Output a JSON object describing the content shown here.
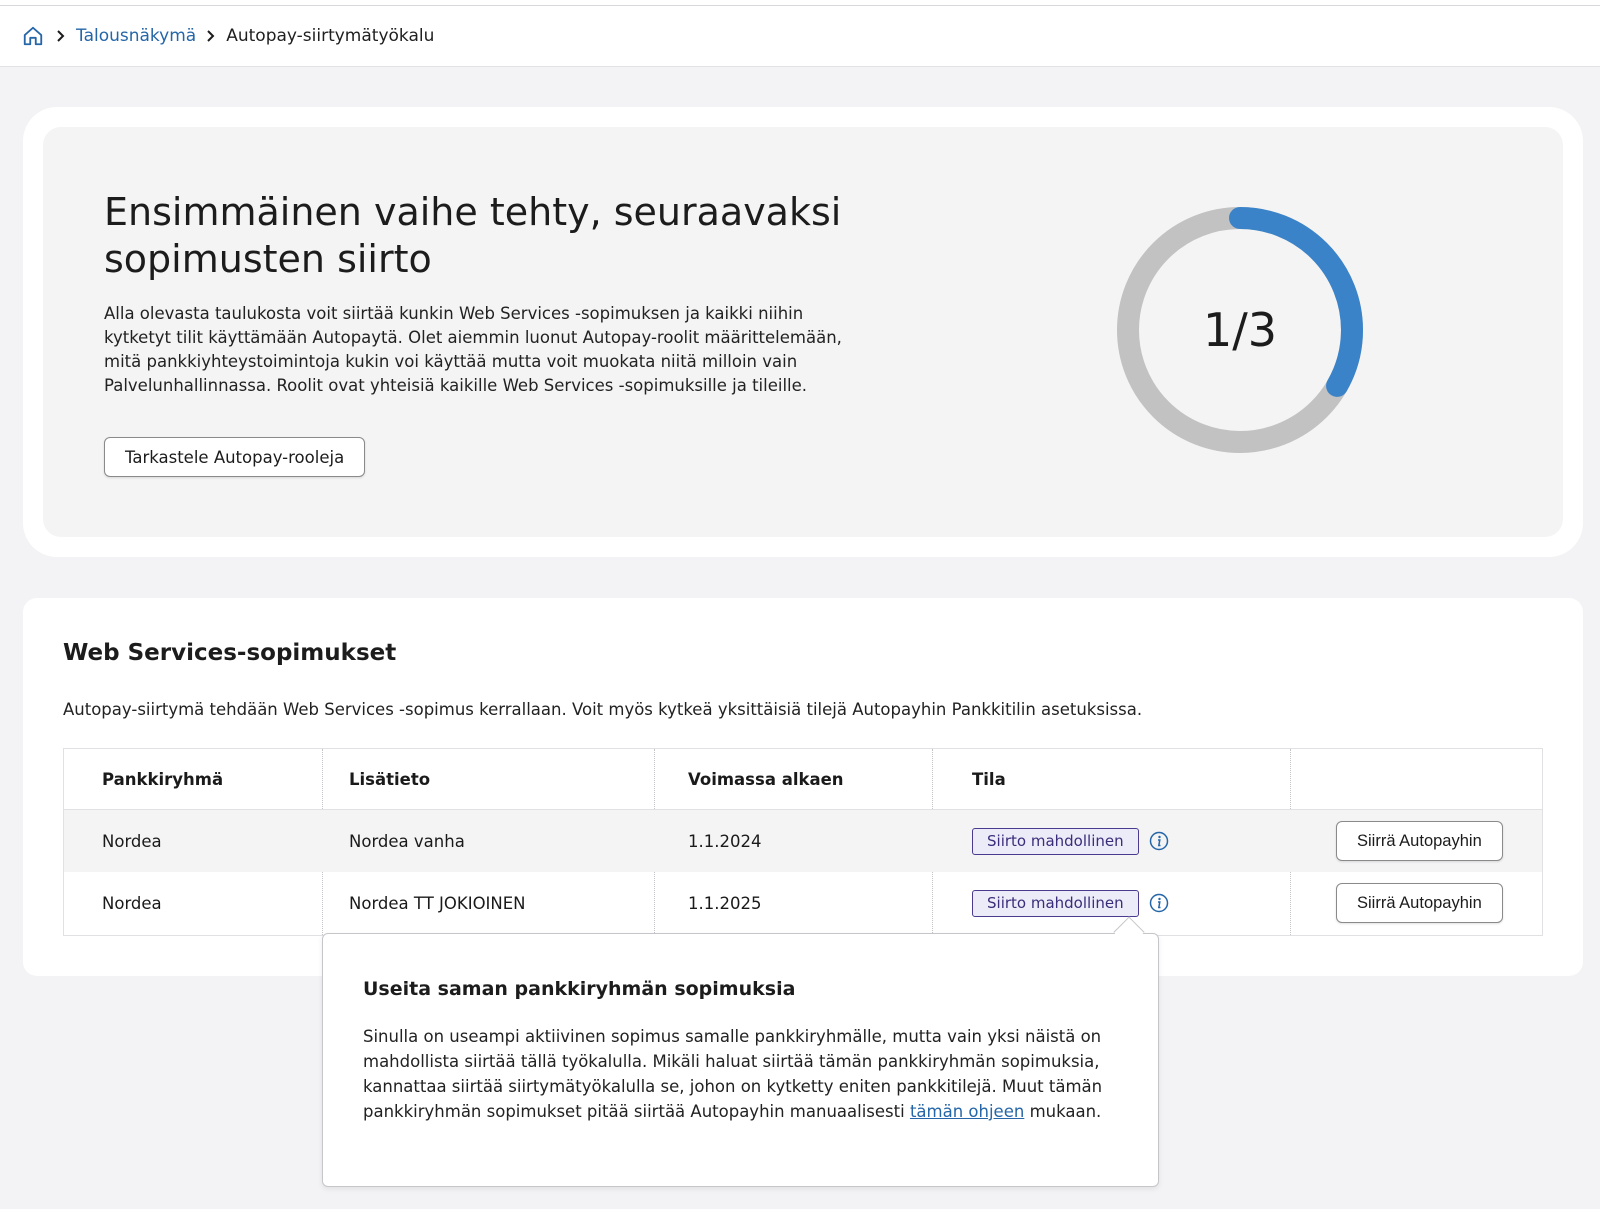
{
  "breadcrumb": {
    "home_icon": "home-icon",
    "items": [
      "Talousnäkymä",
      "Autopay-siirtymätyökalu"
    ]
  },
  "hero": {
    "title": "Ensimmäinen vaihe tehty, seuraavaksi sopimusten siirto",
    "text": "Alla olevasta taulukosta voit siirtää kunkin Web Services -sopimuksen ja kaikki niihin kytketyt tilit käyttämään Autopaytä. Olet aiemmin luonut Autopay-roolit määrittelemään, mitä pankkiyhteystoimintoja kukin voi käyttää mutta voit muokata niitä milloin vain Palvelunhallinnassa. Roolit ovat yhteisiä kaikille Web Services -sopimuksille ja tileille.",
    "button_label": "Tarkastele Autopay-rooleja",
    "progress": {
      "current": 1,
      "total": 3,
      "label": "1/3",
      "fill_fraction": 0.333
    }
  },
  "colors": {
    "accent": "#3a83c9",
    "track": "#c2c2c2",
    "link": "#2566a8",
    "badge_border": "#4b3a8e"
  },
  "contracts": {
    "title": "Web Services-sopimukset",
    "description": "Autopay-siirtymä tehdään Web Services -sopimus kerrallaan. Voit myös kytkeä yksittäisiä tilejä Autopayhin Pankkitilin asetuksissa.",
    "columns": [
      "Pankkiryhmä",
      "Lisätieto",
      "Voimassa alkaen",
      "Tila"
    ],
    "rows": [
      {
        "bank_group": "Nordea",
        "info": "Nordea vanha",
        "valid_from": "1.1.2024",
        "status": "Siirto mahdollinen",
        "action": "Siirrä Autopayhin"
      },
      {
        "bank_group": "Nordea",
        "info": "Nordea TT JOKIOINEN",
        "valid_from": "1.1.2025",
        "status": "Siirto mahdollinen",
        "action": "Siirrä Autopayhin"
      }
    ]
  },
  "popover": {
    "title": "Useita saman pankkiryhmän sopimuksia",
    "text_before_link": "Sinulla on useampi aktiivinen sopimus samalle pankkiryhmälle, mutta vain yksi näistä on mahdollista siirtää tällä työkalulla. Mikäli haluat siirtää tämän pankkiryhmän sopimuksia, kannattaa siirtää siirtymätyökalulla se, johon on kytketty eniten pankkitilejä. Muut tämän pankkiryhmän sopimukset pitää siirtää Autopayhin manuaalisesti ",
    "link_text": "tämän ohjeen",
    "text_after_link": " mukaan."
  }
}
